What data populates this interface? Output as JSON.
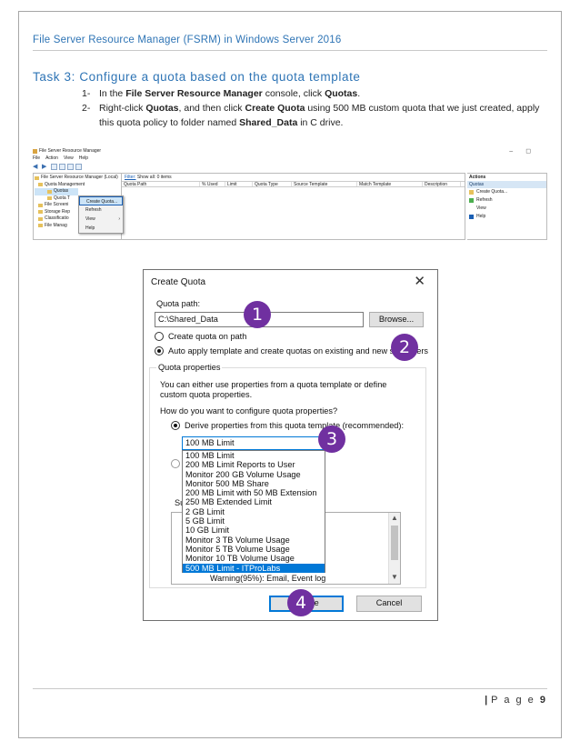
{
  "document": {
    "header": "File Server Resource Manager (FSRM) in Windows Server 2016",
    "task_title": "Task 3: Configure a quota based on the quota template",
    "steps": [
      {
        "num": "1-",
        "parts": [
          "In the ",
          "File Server Resource Manager",
          " console, click ",
          "Quotas",
          "."
        ]
      },
      {
        "num": "2-",
        "parts": [
          "Right-click ",
          "Quotas",
          ", and then click ",
          "Create Quota",
          " using 500 MB custom quota that we just created, apply this quota policy to folder named ",
          "Shared_Data",
          " in C drive."
        ]
      }
    ],
    "footer": {
      "page_label": "P a g e",
      "page_number": "9"
    }
  },
  "fsrm_window": {
    "title": "File Server Resource Manager",
    "menu": [
      "File",
      "Action",
      "View",
      "Help"
    ],
    "tree": [
      "File Server Resource Manager (Local)",
      "Quota Management",
      "Quotas",
      "Quota T",
      "File Screeni",
      "Storage Rep",
      "Classificatio",
      "File Manag"
    ],
    "context_menu": [
      "Create Quota...",
      "Refresh",
      "View",
      "Help"
    ],
    "filter_label": "Filter:",
    "filter_text": "Show all: 0 items",
    "columns": [
      "Quota Path",
      "% Used",
      "Limit",
      "Quota Type",
      "Source Template",
      "Match Template",
      "Description"
    ],
    "actions_title": "Actions",
    "actions_section": "Quotas",
    "actions": [
      "Create Quota...",
      "Refresh",
      "View",
      "Help"
    ]
  },
  "create_quota_dialog": {
    "title": "Create Quota",
    "quota_path_label": "Quota path:",
    "quota_path_value": "C:\\Shared_Data",
    "browse_label": "Browse...",
    "radio_create_on_path": "Create quota on path",
    "radio_auto_apply": "Auto apply template and create quotas on existing and new subfolders",
    "quota_properties_legend": "Quota properties",
    "quota_properties_desc": "You can either use properties from a quota template or define custom quota properties.",
    "how_configure_label": "How do you want to configure quota properties?",
    "radio_derive": "Derive properties from this quota template (recommended):",
    "template_selected": "100 MB Limit",
    "template_options": [
      "100 MB Limit",
      "200 MB Limit Reports to User",
      "Monitor 200 GB Volume Usage",
      "Monitor 500 MB Share",
      "200 MB Limit with 50 MB Extension",
      "250 MB Extended Limit",
      "2 GB Limit",
      "5 GB Limit",
      "10 GB Limit",
      "Monitor 3 TB Volume Usage",
      "Monitor 5 TB Volume Usage",
      "Monitor 10 TB Volume Usage",
      "500 MB Limit - ITProLabs"
    ],
    "highlighted_option": "500 MB Limit - ITProLabs",
    "summary_label": "Sur",
    "summary_last_line": "Warning(95%): Email, Event log",
    "create_label": "Create",
    "cancel_label": "Cancel"
  },
  "callouts": [
    "1",
    "2",
    "3",
    "4"
  ],
  "colors": {
    "callout": "#7030a0",
    "heading": "#2e74b5",
    "selection": "#0078d7"
  }
}
